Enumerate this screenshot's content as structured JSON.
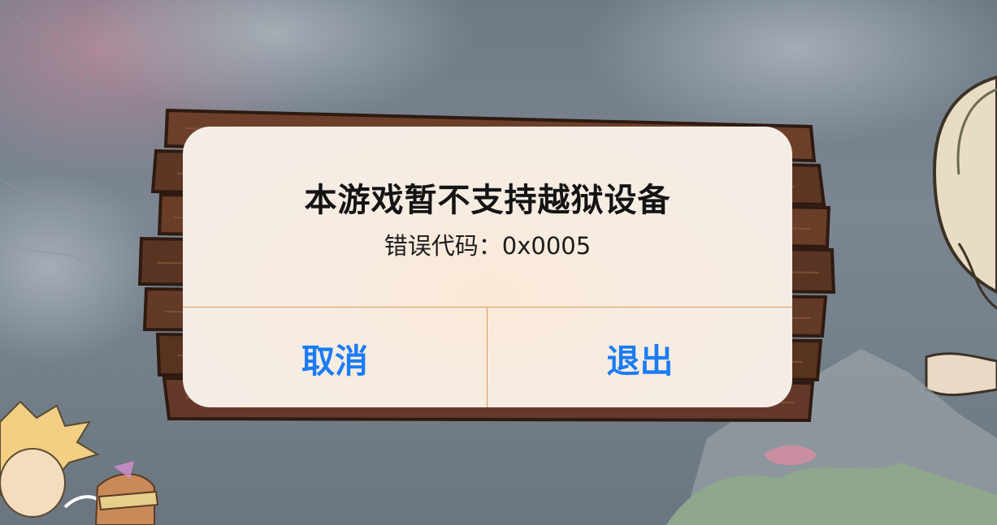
{
  "dialog": {
    "title": "本游戏暂不支持越狱设备",
    "message": "错误代码：0x0005",
    "buttons": {
      "cancel": "取消",
      "quit": "退出"
    }
  },
  "colors": {
    "button_text": "#1a7cf5",
    "divider": "#d79a5a",
    "dialog_bg": "#f6ece2",
    "wood": "#5a3524"
  }
}
